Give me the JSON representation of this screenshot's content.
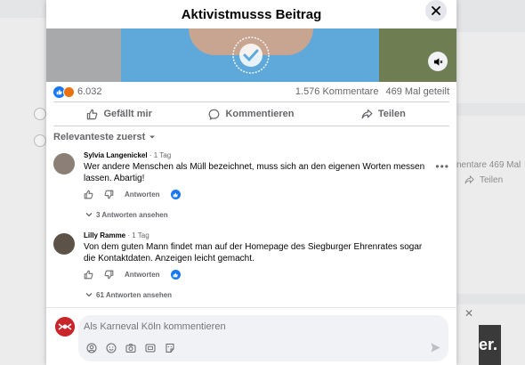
{
  "modal": {
    "title": "Aktivistmusss Beitrag"
  },
  "post": {
    "reaction_count": "6.032",
    "comment_count": "1.576 Kommentare",
    "share_count": "469 Mal geteilt"
  },
  "actions": {
    "like": "Gefällt mir",
    "comment": "Kommentieren",
    "share": "Teilen"
  },
  "sort": {
    "label": "Relevanteste zuerst"
  },
  "comments": [
    {
      "author": "Sylvia Langenickel",
      "time": "· 1 Tag",
      "text": "Wer andere Menschen als Müll bezeichnet, muss sich an den eigenen Worten messen lassen. Abartig!",
      "reply_label": "Antworten",
      "replies_link": "3 Antworten ansehen"
    },
    {
      "author": "Lilly Ramme",
      "time": "· 1 Tag",
      "text": "Von dem guten Mann findet man auf der Homepage des Siegburger Ehrenrates sogar die Kontaktdaten. Anzeigen leicht gemacht.",
      "reply_label": "Antworten",
      "replies_link": "61 Antworten ansehen"
    }
  ],
  "composer": {
    "placeholder": "Als Karneval Köln kommentieren"
  },
  "background": {
    "stats_fragment": "nentare  469 Mal",
    "share_fragment": "Teilen",
    "ad_fragment": "er."
  },
  "colors": {
    "accent": "#1877f2",
    "angry": "#e9710f",
    "muted_text": "#65676b"
  }
}
